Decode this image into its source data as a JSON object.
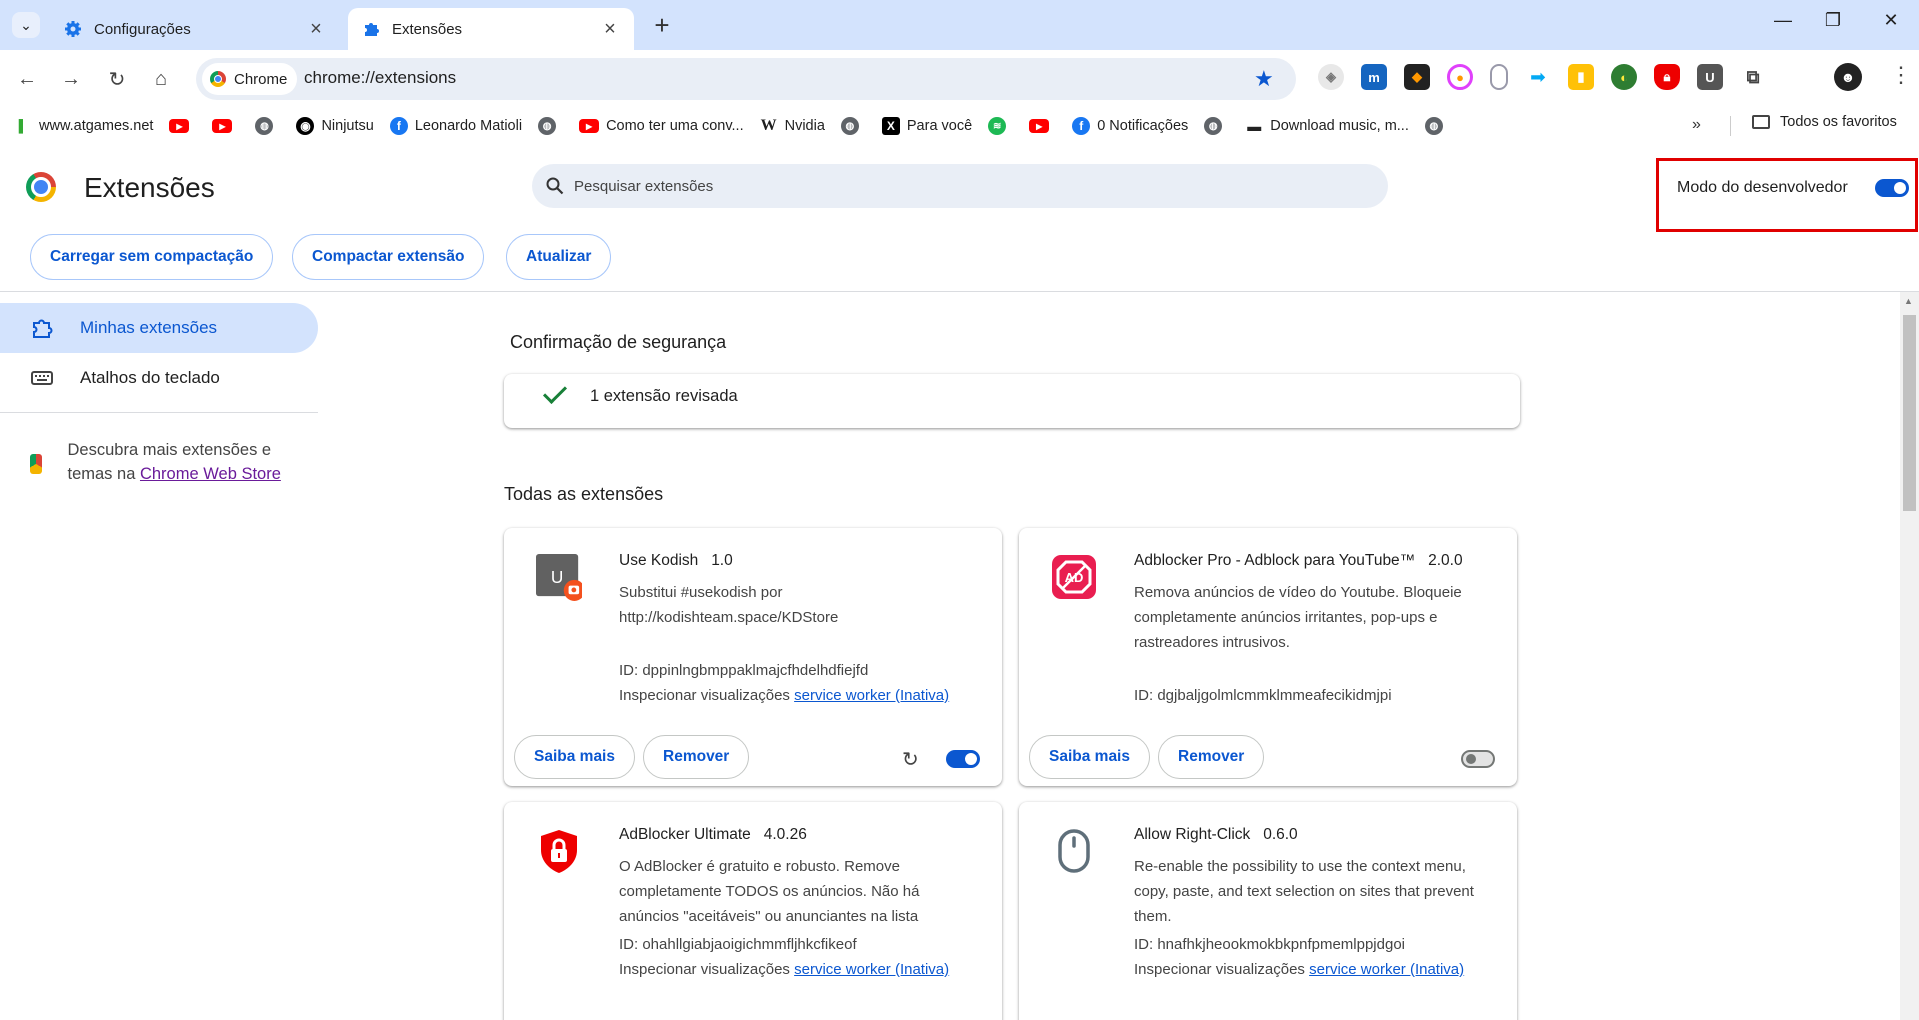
{
  "browser": {
    "tabs": [
      {
        "label": "Configurações",
        "icon": "gear-icon"
      },
      {
        "label": "Extensões",
        "icon": "puzzle-icon"
      }
    ],
    "omnibox": {
      "chip": "Chrome",
      "url": "chrome://extensions"
    },
    "toolbar_extension_icons": [
      "shield-icon",
      "blue-app-icon",
      "orange-diamond-icon",
      "pink-circle-icon",
      "mouse-icon",
      "arrow-icon",
      "yellow-app-icon",
      "globe-green-icon",
      "red-shield-icon",
      "u-icon",
      "puzzle-icon"
    ],
    "bookmarks": [
      {
        "label": "www.atgames.net",
        "icon": "atgames-icon"
      },
      {
        "label": "",
        "icon": "youtube-icon"
      },
      {
        "label": "",
        "icon": "youtube-icon"
      },
      {
        "label": "",
        "icon": "globe-icon"
      },
      {
        "label": "Ninjutsu",
        "icon": "github-icon"
      },
      {
        "label": "Leonardo Matioli",
        "icon": "facebook-icon"
      },
      {
        "label": "",
        "icon": "globe-icon"
      },
      {
        "label": "Como ter uma conv...",
        "icon": "youtube-icon"
      },
      {
        "label": "Nvidia",
        "icon": "wikipedia-icon"
      },
      {
        "label": "",
        "icon": "globe-icon"
      },
      {
        "label": "Para você",
        "icon": "x-icon"
      },
      {
        "label": "",
        "icon": "spotify-icon"
      },
      {
        "label": "",
        "icon": "youtube-icon"
      },
      {
        "label": "0 Notificações",
        "icon": "facebook-icon"
      },
      {
        "label": "",
        "icon": "globe-icon"
      },
      {
        "label": "Download music, m...",
        "icon": "car-icon"
      },
      {
        "label": "",
        "icon": "globe-icon"
      }
    ],
    "bookmarks_more": "»",
    "bookmarks_folder": "Todos os favoritos"
  },
  "header": {
    "title": "Extensões",
    "search_placeholder": "Pesquisar extensões",
    "dev_mode_label": "Modo do desenvolvedor",
    "dev_mode_on": true,
    "actions": {
      "load_unpacked": "Carregar sem compactação",
      "pack": "Compactar extensão",
      "update": "Atualizar"
    }
  },
  "sidebar": {
    "items": [
      {
        "label": "Minhas extensões",
        "icon": "puzzle-icon"
      },
      {
        "label": "Atalhos do teclado",
        "icon": "keyboard-icon"
      }
    ],
    "promo_text": "Descubra mais extensões e temas na",
    "promo_link": "Chrome Web Store"
  },
  "main": {
    "safety_title": "Confirmação de segurança",
    "safety_result": "1 extensão revisada",
    "all_title": "Todas as extensões",
    "inspect_label": "Inspecionar visualizações",
    "learn_more": "Saiba mais",
    "remove": "Remover",
    "extensions": [
      {
        "name": "Use Kodish",
        "version": "1.0",
        "description": "Substitui #usekodish por http://kodishteam.space/KDStore",
        "id": "ID: dppinlngbmppaklmajcfhdelhdfiejfd",
        "service_worker": "service worker (Inativa)",
        "enabled": true,
        "icon": "u-icon"
      },
      {
        "name": "Adblocker Pro - Adblock para YouTube™",
        "version": "2.0.0",
        "description": "Remova anúncios de vídeo do Youtube. Bloqueie completamente anúncios irritantes, pop-ups e rastreadores intrusivos.",
        "id": "ID: dgjbaljgolmlcmmklmmeafecikidmjpi",
        "service_worker": "",
        "enabled": false,
        "icon": "ad-block-icon"
      },
      {
        "name": "AdBlocker Ultimate",
        "version": "4.0.26",
        "description": "O AdBlocker é gratuito e robusto. Remove completamente TODOS os anúncios. Não há anúncios \"aceitáveis\" ou anunciantes na lista",
        "id": "ID: ohahllgiabjaoigichmmfljhkcfikeof",
        "service_worker": "service worker (Inativa)",
        "icon": "red-shield-lock-icon"
      },
      {
        "name": "Allow Right-Click",
        "version": "0.6.0",
        "description": "Re-enable the possibility to use the context menu, copy, paste, and text selection on sites that prevent them.",
        "id": "ID: hnafhkjheookmokbkpnfpmemlppjdgoi",
        "service_worker": "service worker (Inativa)",
        "icon": "mouse-icon"
      }
    ]
  },
  "colors": {
    "accent": "#0b57d0",
    "tabstrip": "#d3e3fd",
    "highlight_box": "#e00000"
  }
}
